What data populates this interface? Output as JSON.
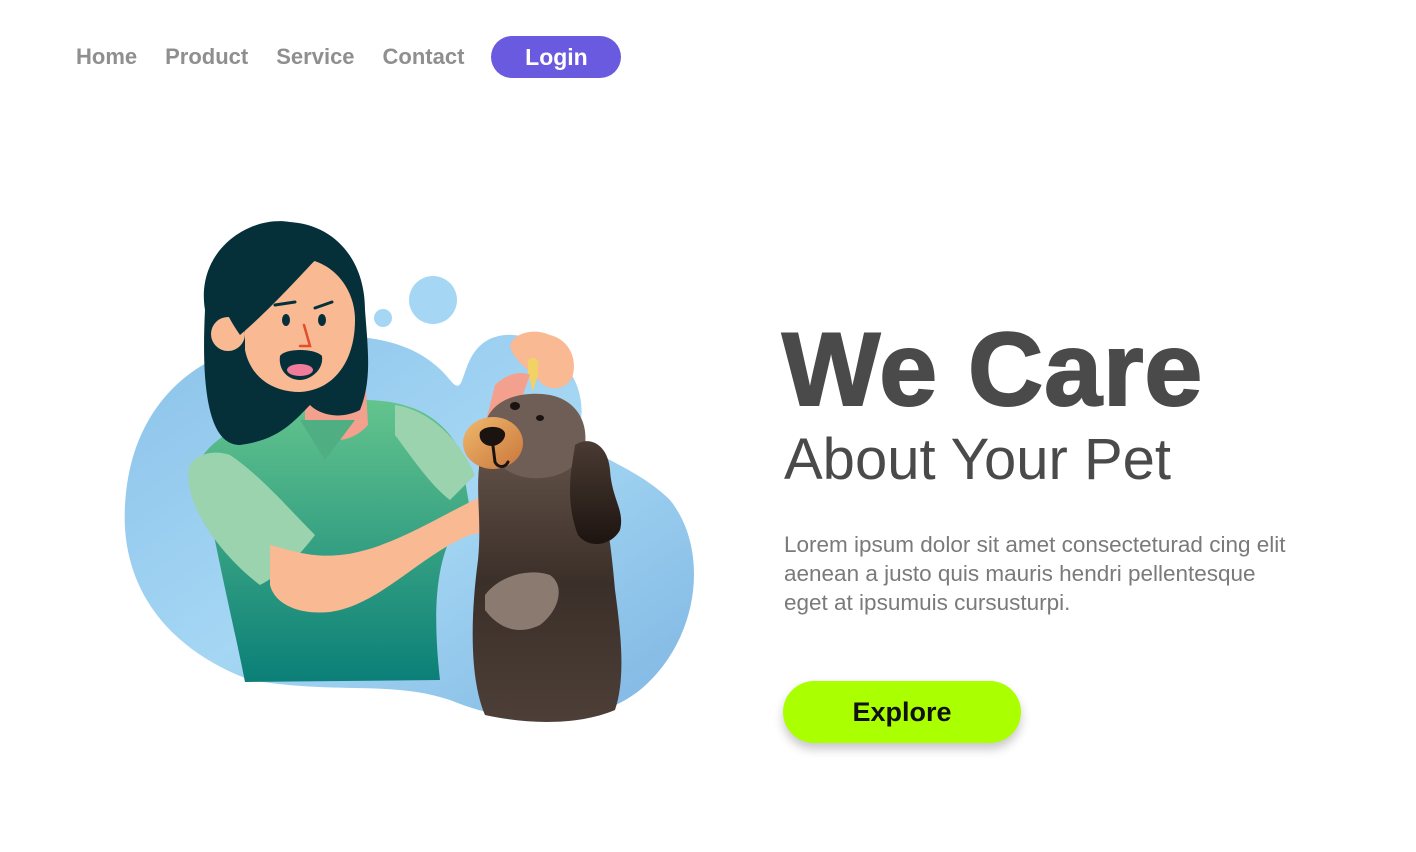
{
  "nav": {
    "items": [
      {
        "label": "Home"
      },
      {
        "label": "Product"
      },
      {
        "label": "Service"
      },
      {
        "label": "Contact"
      }
    ],
    "login_label": "Login"
  },
  "hero": {
    "title": "We Care",
    "subtitle": "About Your Pet",
    "description": "Lorem ipsum dolor sit amet consecteturad cing elit aenean a justo quis mauris hendri pellentesque eget at ipsumuis cursusturpi.",
    "explore_label": "Explore"
  },
  "illustration": {
    "icon": "woman-giving-dog-eye-drops-illustration"
  },
  "colors": {
    "nav_text": "#8f8f8f",
    "login_bg": "#6a5ae0",
    "heading": "#4a4a4a",
    "body_text": "#7a7a7a",
    "explore_bg": "#aaff00",
    "blob_blue": "#9fd3f2"
  }
}
